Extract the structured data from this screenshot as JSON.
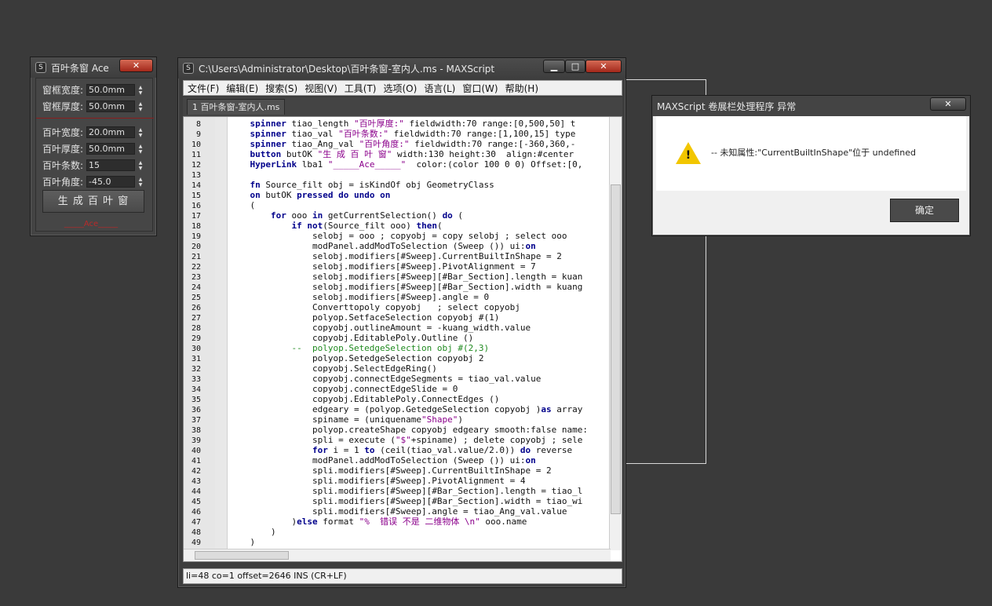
{
  "rollout": {
    "title": "百叶条窗 Ace",
    "close": "✕",
    "fields": [
      {
        "label": "窗框宽度:",
        "value": "50.0mm"
      },
      {
        "label": "窗框厚度:",
        "value": "50.0mm"
      },
      {
        "label": "百叶宽度:",
        "value": "20.0mm"
      },
      {
        "label": "百叶厚度:",
        "value": "50.0mm"
      },
      {
        "label": "百叶条数:",
        "value": "15"
      },
      {
        "label": "百叶角度:",
        "value": "-45.0"
      }
    ],
    "generate_button": "生 成 百 叶 窗",
    "hyperlink": "_____Ace_____"
  },
  "editor": {
    "title": "C:\\Users\\Administrator\\Desktop\\百叶条窗-室内人.ms - MAXScript",
    "minimize": "▁",
    "maximize": "□",
    "close": "✕",
    "menu": [
      "文件(F)",
      "编辑(E)",
      "搜索(S)",
      "视图(V)",
      "工具(T)",
      "选项(O)",
      "语言(L)",
      "窗口(W)",
      "帮助(H)"
    ],
    "tab": "1 百叶条窗-室内人.ms",
    "status": "li=48 co=1 offset=2646 INS (CR+LF)",
    "line_numbers": [
      "8",
      "9",
      "10",
      "11",
      "12",
      "13",
      "14",
      "15",
      "16",
      "17",
      "18",
      "19",
      "20",
      "21",
      "22",
      "23",
      "24",
      "25",
      "26",
      "27",
      "28",
      "29",
      "30",
      "31",
      "32",
      "33",
      "34",
      "35",
      "36",
      "37",
      "38",
      "39",
      "40",
      "41",
      "42",
      "43",
      "44",
      "45",
      "46",
      "47",
      "48",
      "49"
    ],
    "code_lines": [
      "    spinner tiao_length \"百叶厚度:\" fieldwidth:70 range:[0,500,50] t",
      "    spinner tiao_val \"百叶条数:\" fieldwidth:70 range:[1,100,15] type",
      "    spinner tiao_Ang_val \"百叶角度:\" fieldwidth:70 range:[-360,360,-",
      "    button butOK \"生 成 百 叶 窗\" width:130 height:30  align:#center",
      "    HyperLink lba1 \"_____Ace_____\"  color:(color 100 0 0) Offset:[0,",
      "",
      "    fn Source_filt obj = isKindOf obj GeometryClass",
      "    on butOK pressed do undo on",
      "    (",
      "        for ooo in getCurrentSelection() do (",
      "            if not(Source_filt ooo) then(",
      "                selobj = ooo ; copyobj = copy selobj ; select ooo",
      "                modPanel.addModToSelection (Sweep ()) ui:on",
      "                selobj.modifiers[#Sweep].CurrentBuiltInShape = 2",
      "                selobj.modifiers[#Sweep].PivotAlignment = 7",
      "                selobj.modifiers[#Sweep][#Bar_Section].length = kuan",
      "                selobj.modifiers[#Sweep][#Bar_Section].width = kuang",
      "                selobj.modifiers[#Sweep].angle = 0",
      "                Converttopoly copyobj   ; select copyobj",
      "                polyop.SetfaceSelection copyobj #(1)",
      "                copyobj.outlineAmount = -kuang_width.value",
      "                copyobj.EditablePoly.Outline ()",
      "            --  polyop.SetedgeSelection obj #(2,3)",
      "                polyop.SetedgeSelection copyobj 2",
      "                copyobj.SelectEdgeRing()",
      "                copyobj.connectEdgeSegments = tiao_val.value",
      "                copyobj.connectEdgeSlide = 0",
      "                copyobj.EditablePoly.ConnectEdges ()",
      "                edgeary = (polyop.GetedgeSelection copyobj )as array",
      "                spiname = (uniquename\"Shape\")",
      "                polyop.createShape copyobj edgeary smooth:false name:",
      "                spli = execute (\"$\"+spiname) ; delete copyobj ; sele",
      "                for i = 1 to (ceil(tiao_val.value/2.0)) do reverse",
      "                modPanel.addModToSelection (Sweep ()) ui:on",
      "                spli.modifiers[#Sweep].CurrentBuiltInShape = 2",
      "                spli.modifiers[#Sweep].PivotAlignment = 4",
      "                spli.modifiers[#Sweep][#Bar_Section].length = tiao_l",
      "                spli.modifiers[#Sweep][#Bar_Section].width = tiao_wi",
      "                spli.modifiers[#Sweep].angle = tiao_Ang_val.value",
      "            )else format \"%  错误 不是 二维物体 \\n\" ooo.name",
      "        )",
      "    )"
    ]
  },
  "dialog": {
    "title": "MAXScript 卷展栏处理程序 异常",
    "close": "✕",
    "message": "-- 未知属性:\"CurrentBuiltInShape\"位于 undefined",
    "warning_mark": "!",
    "ok_button": "确定"
  },
  "colors": {
    "background": "#3a3a3a",
    "keyword": "#00008b",
    "function": "#8b008b",
    "number": "#0a8a8a",
    "comment": "#1f8a1f",
    "hyperlink": "#b92a2a",
    "warning": "#f2c600"
  }
}
